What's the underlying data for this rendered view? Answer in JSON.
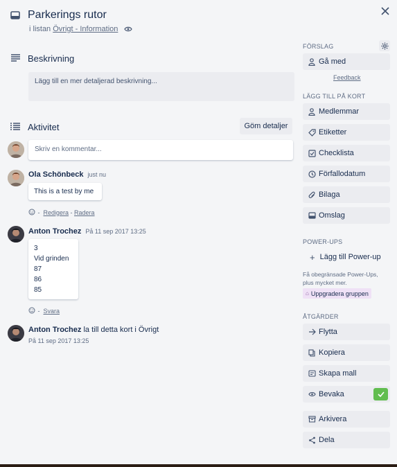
{
  "card": {
    "title": "Parkerings rutor",
    "list_prefix": "i listan",
    "list_name": "Övrigt - Information"
  },
  "description": {
    "heading": "Beskrivning",
    "placeholder": "Lägg till en mer detaljerad beskrivning..."
  },
  "activity": {
    "heading": "Aktivitet",
    "toggle_button": "Göm detaljer",
    "comment_placeholder": "Skriv en kommentar...",
    "entries": [
      {
        "author": "Ola Schönbeck",
        "time": "just nu",
        "text": "This is a test by me",
        "actions": [
          "Redigera",
          "Radera"
        ]
      },
      {
        "author": "Anton Trochez",
        "time": "På 11 sep 2017 13:25",
        "lines": [
          "3",
          "Vid grinden",
          "87",
          "86",
          "85"
        ],
        "actions": [
          "Svara"
        ]
      },
      {
        "author": "Anton Trochez",
        "text": "la till detta kort i Övrigt",
        "time": "På 11 sep 2017 13:25"
      }
    ]
  },
  "sidebar": {
    "suggestions_label": "FÖRSLAG",
    "join_button": "Gå med",
    "feedback_link": "Feedback",
    "add_label": "LÄGG TILL PÅ KORT",
    "add_items": [
      "Medlemmar",
      "Etiketter",
      "Checklista",
      "Förfallodatum",
      "Bilaga",
      "Omslag"
    ],
    "powerups_label": "POWER-UPS",
    "add_powerup": "Lägg till Power-up",
    "powerups_note": "Få obegränsade Power-Ups, plus mycket mer.",
    "upgrade_link": "Uppgradera gruppen",
    "actions_label": "ÅTGÄRDER",
    "action_items": [
      "Flytta",
      "Kopiera",
      "Skapa mall",
      "Bevaka"
    ],
    "archive": "Arkivera",
    "share": "Dela",
    "watch_check_color": "#61bd4f"
  },
  "icons": {
    "close": "close-icon",
    "card": "card-icon",
    "watch": "eye-icon",
    "description": "lines-icon",
    "activity": "list-icon",
    "settings": "gear-icon"
  }
}
